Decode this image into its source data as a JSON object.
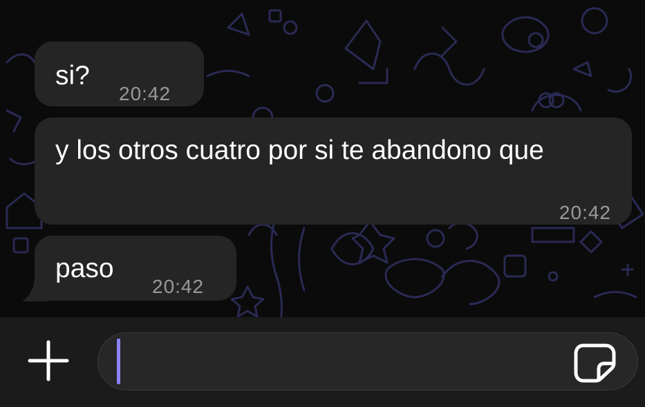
{
  "messages": [
    {
      "text": "si?",
      "time": "20:42"
    },
    {
      "text": "y los otros cuatro por si te abandono que",
      "time": "20:42"
    },
    {
      "text": "paso",
      "time": "20:42"
    }
  ],
  "composer": {
    "plus_icon": "plus-icon",
    "sticker_icon": "sticker-icon",
    "input_value": "",
    "caret_color": "#8a84f5"
  },
  "colors": {
    "background": "#0b0b0b",
    "bubble": "#252525",
    "doodle": "#2a2a55",
    "time": "#9a9a9a"
  }
}
